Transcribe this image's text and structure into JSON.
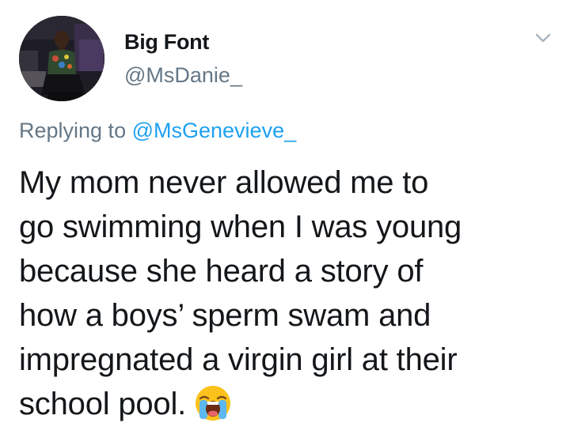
{
  "author": {
    "display_name": "Big Font",
    "handle": "@MsDanie_"
  },
  "reply": {
    "prefix": "Replying to",
    "mention": "@MsGenevieve_"
  },
  "tweet": {
    "lines": [
      "My mom never allowed me to",
      "go swimming when I was young",
      "because she heard a story of",
      "how a boys’ sperm swam and",
      "impregnated a virgin girl at their",
      "school pool."
    ],
    "emoji": "loudly-crying-face-emoji"
  },
  "icons": {
    "menu": "chevron-down-icon",
    "avatar": "profile-photo"
  },
  "colors": {
    "text_primary": "#14171a",
    "text_secondary": "#657786",
    "accent": "#1da1f2",
    "background": "#ffffff"
  }
}
